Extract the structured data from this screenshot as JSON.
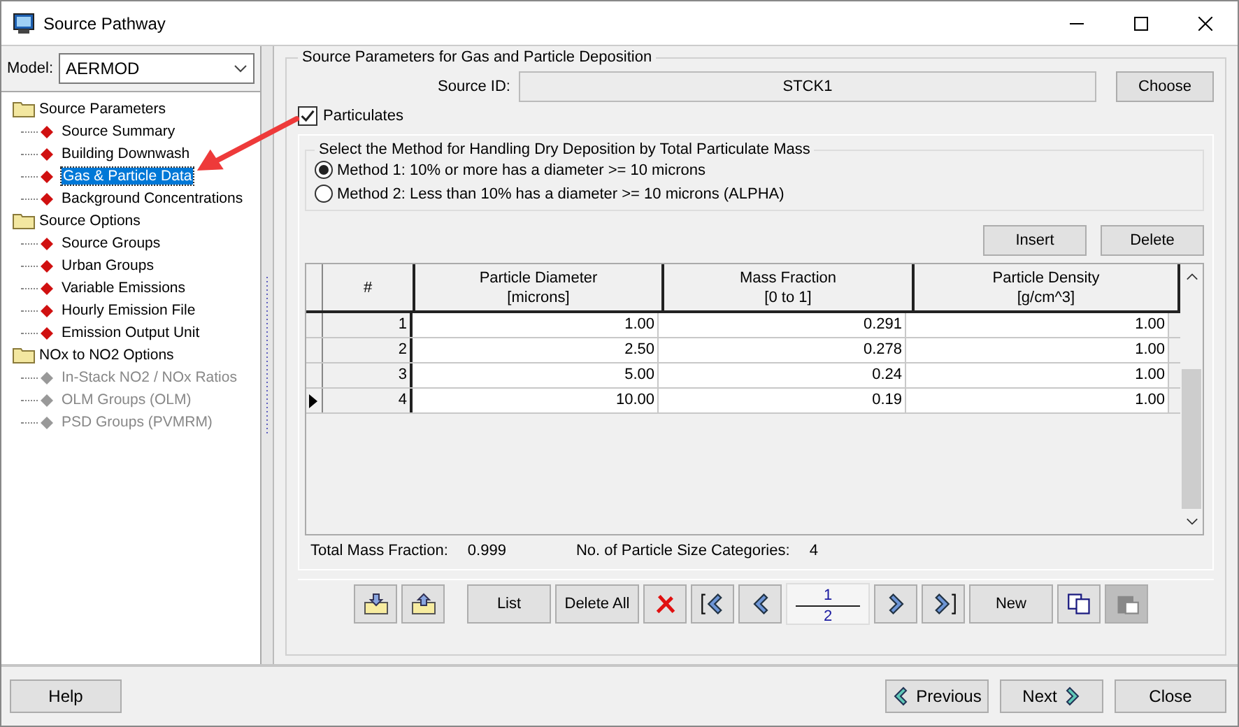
{
  "window": {
    "title": "Source Pathway"
  },
  "model": {
    "label": "Model:",
    "value": "AERMOD"
  },
  "tree": [
    {
      "label": "Source Parameters",
      "children": [
        {
          "label": "Source Summary",
          "selected": false,
          "disabled": false
        },
        {
          "label": "Building Downwash",
          "selected": false,
          "disabled": false
        },
        {
          "label": "Gas & Particle Data",
          "selected": true,
          "disabled": false
        },
        {
          "label": "Background Concentrations",
          "selected": false,
          "disabled": false
        }
      ]
    },
    {
      "label": "Source Options",
      "children": [
        {
          "label": "Source Groups",
          "selected": false,
          "disabled": false
        },
        {
          "label": "Urban Groups",
          "selected": false,
          "disabled": false
        },
        {
          "label": "Variable Emissions",
          "selected": false,
          "disabled": false
        },
        {
          "label": "Hourly Emission File",
          "selected": false,
          "disabled": false
        },
        {
          "label": "Emission Output Unit",
          "selected": false,
          "disabled": false
        }
      ]
    },
    {
      "label": "NOx to NO2 Options",
      "children": [
        {
          "label": "In-Stack NO2 / NOx Ratios",
          "selected": false,
          "disabled": true
        },
        {
          "label": "OLM Groups (OLM)",
          "selected": false,
          "disabled": true
        },
        {
          "label": "PSD Groups (PVMRM)",
          "selected": false,
          "disabled": true
        }
      ]
    }
  ],
  "group_title": "Source Parameters for Gas and Particle Deposition",
  "source_id": {
    "label": "Source ID:",
    "value": "STCK1",
    "button": "Choose"
  },
  "particulates": {
    "label": "Particulates",
    "checked": true
  },
  "method": {
    "title": "Select the Method for Handling Dry Deposition by Total Particulate Mass",
    "options": [
      {
        "label": "Method 1: 10% or more has a diameter >= 10 microns",
        "selected": true
      },
      {
        "label": "Method 2: Less than 10% has a diameter >= 10 microns (ALPHA)",
        "selected": false
      }
    ]
  },
  "grid_buttons": [
    "Insert",
    "Delete"
  ],
  "table": {
    "columns": [
      {
        "title": "#"
      },
      {
        "title": "Particle Diameter",
        "unit": "[microns]"
      },
      {
        "title": "Mass Fraction",
        "unit": "[0 to 1]"
      },
      {
        "title": "Particle Density",
        "unit": "[g/cm^3]"
      }
    ],
    "rows": [
      {
        "current": false,
        "cells": [
          "1",
          "1.00",
          "0.291",
          "1.00"
        ]
      },
      {
        "current": false,
        "cells": [
          "2",
          "2.50",
          "0.278",
          "1.00"
        ]
      },
      {
        "current": false,
        "cells": [
          "3",
          "5.00",
          "0.24",
          "1.00"
        ]
      },
      {
        "current": true,
        "cells": [
          "4",
          "10.00",
          "0.19",
          "1.00"
        ]
      }
    ]
  },
  "totals": [
    {
      "label": "Total Mass Fraction:",
      "value": "0.999"
    },
    {
      "label": "No. of Particle Size Categories:",
      "value": "4"
    }
  ],
  "toolbar": {
    "list": "List",
    "delete_all": "Delete All",
    "page": "1",
    "pages": "2",
    "new": "New",
    "paste_disabled": true
  },
  "footer": {
    "help": "Help",
    "previous": "Previous",
    "next": "Next",
    "close": "Close"
  }
}
